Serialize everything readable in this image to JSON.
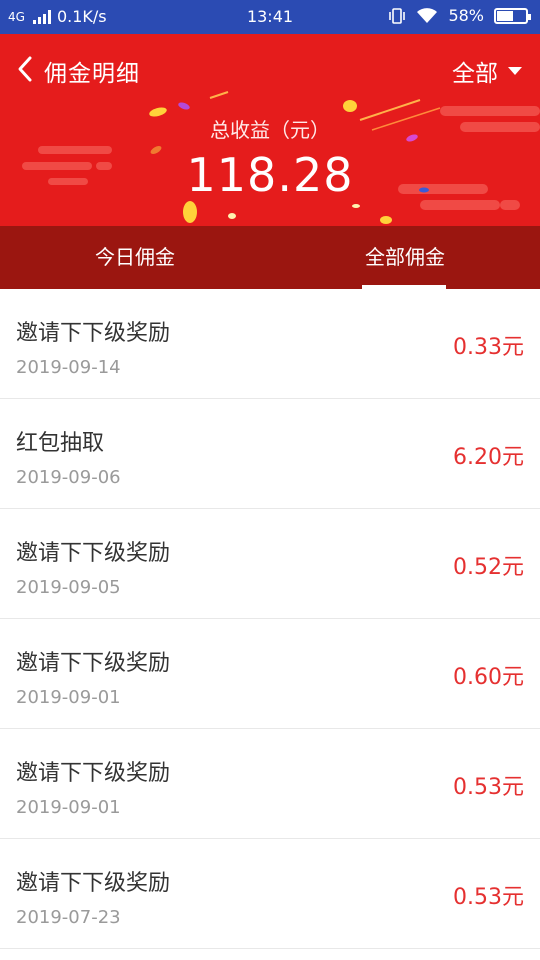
{
  "status_bar": {
    "network": "4G",
    "speed": "0.1K/s",
    "time": "13:41",
    "battery": "58%",
    "battery_level": 0.58
  },
  "header": {
    "title": "佣金明细",
    "filter_label": "全部",
    "total_label": "总收益（元）",
    "total_value": "118.28"
  },
  "tabs": [
    {
      "label": "今日佣金",
      "active": false
    },
    {
      "label": "全部佣金",
      "active": true
    }
  ],
  "records": [
    {
      "title": "邀请下下级奖励",
      "date": "2019-09-14",
      "amount": "0.33元"
    },
    {
      "title": "红包抽取",
      "date": "2019-09-06",
      "amount": "6.20元"
    },
    {
      "title": "邀请下下级奖励",
      "date": "2019-09-05",
      "amount": "0.52元"
    },
    {
      "title": "邀请下下级奖励",
      "date": "2019-09-01",
      "amount": "0.60元"
    },
    {
      "title": "邀请下下级奖励",
      "date": "2019-09-01",
      "amount": "0.53元"
    },
    {
      "title": "邀请下下级奖励",
      "date": "2019-07-23",
      "amount": "0.53元"
    }
  ],
  "colors": {
    "status_bar": "#2b4bb3",
    "header": "#e51c1c",
    "tabs": "#9b1610",
    "amount": "#e53030"
  }
}
